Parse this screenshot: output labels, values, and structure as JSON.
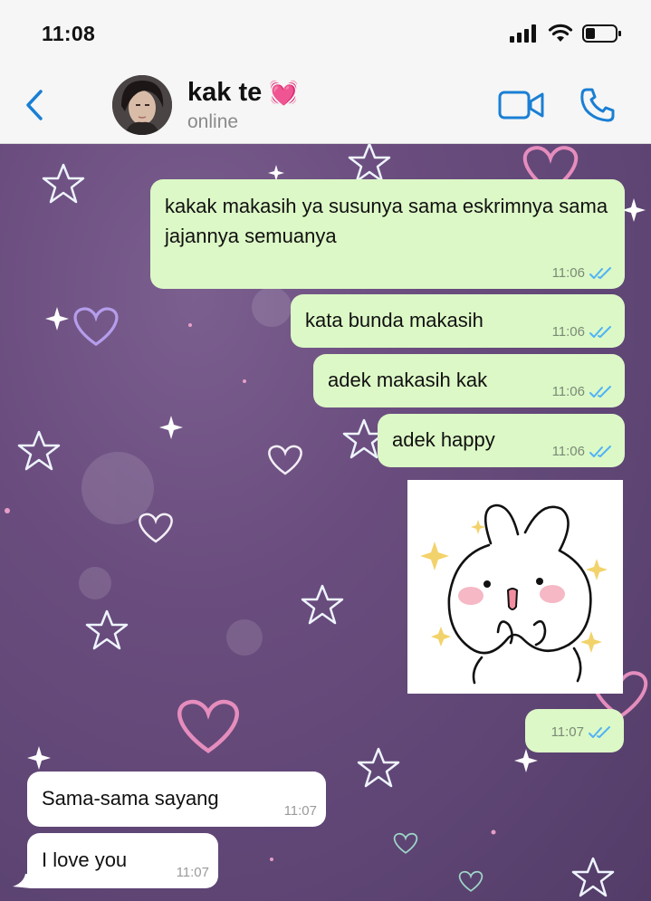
{
  "status_bar": {
    "time": "11:08"
  },
  "header": {
    "contact_name": "kak te",
    "name_emoji": "💓",
    "status": "online"
  },
  "messages": [
    {
      "direction": "outgoing",
      "text": "kakak makasih ya susunya sama eskrimnya sama jajannya semuanya",
      "time": "11:06",
      "read": true
    },
    {
      "direction": "outgoing",
      "text": "kata bunda makasih",
      "time": "11:06",
      "read": true
    },
    {
      "direction": "outgoing",
      "text": "adek makasih kak",
      "time": "11:06",
      "read": true
    },
    {
      "direction": "outgoing",
      "text": "adek happy",
      "time": "11:06",
      "read": true
    },
    {
      "direction": "outgoing",
      "type": "sticker",
      "sticker": "bunny-sticker",
      "time": "11:07",
      "read": true
    },
    {
      "direction": "incoming",
      "text": "Sama-sama sayang",
      "time": "11:07"
    },
    {
      "direction": "incoming",
      "text": "I love you",
      "time": "11:07"
    }
  ],
  "icons": {
    "back": "chevron-left-icon",
    "video": "video-camera-icon",
    "call": "phone-icon",
    "read_receipt": "double-check-icon"
  },
  "colors": {
    "accent": "#1a7fd4",
    "outgoing_bubble": "#dcf8c6",
    "incoming_bubble": "#ffffff",
    "read_tick": "#4fb3f6"
  }
}
